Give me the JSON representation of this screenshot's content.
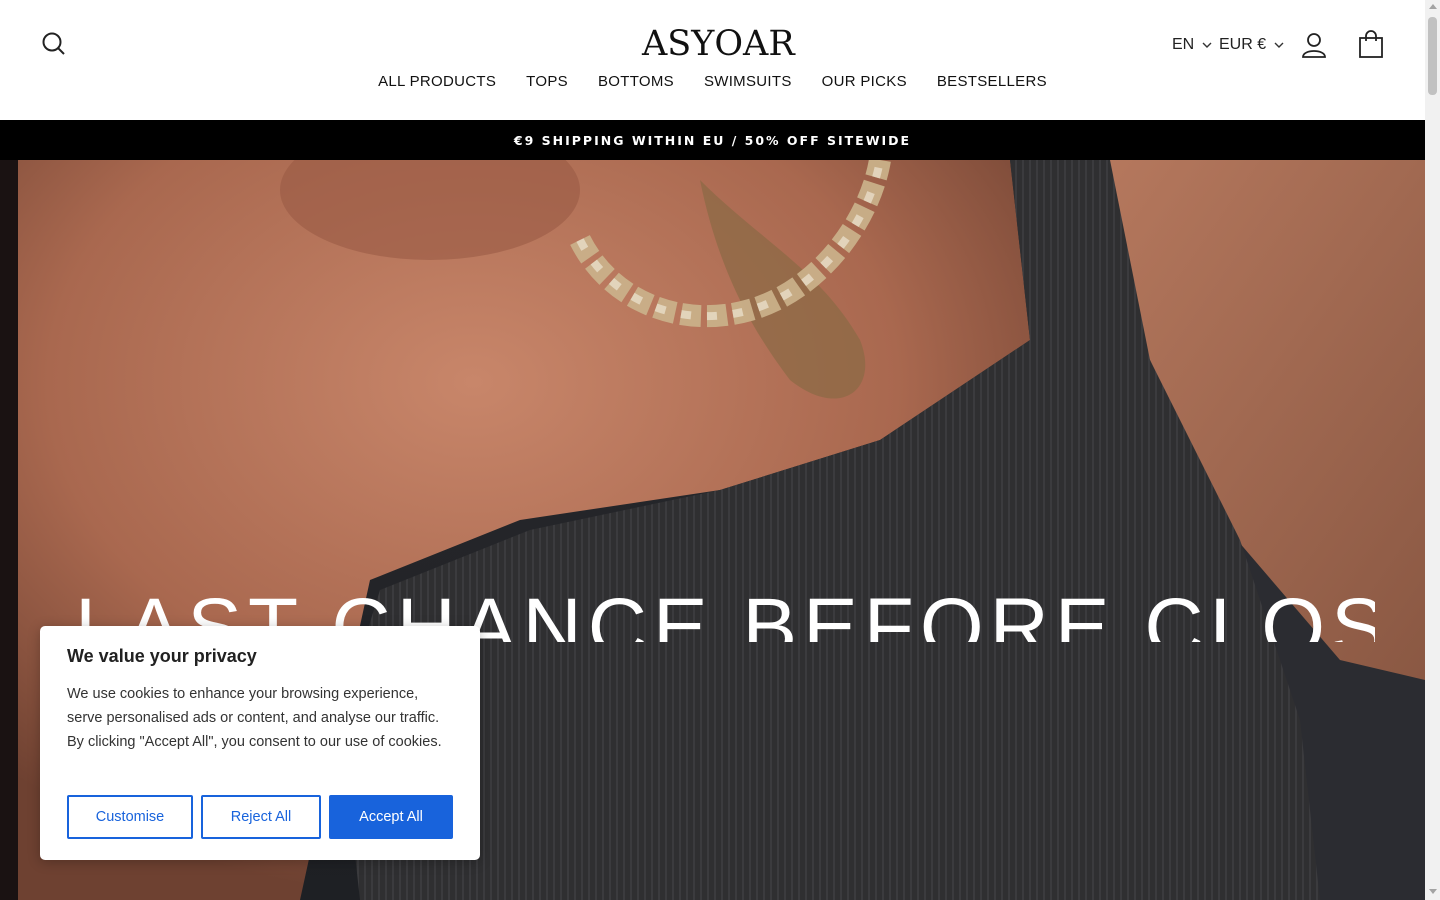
{
  "header": {
    "logo": "ASYOAR",
    "language": "EN",
    "currency": "EUR €",
    "nav": [
      "ALL PRODUCTS",
      "TOPS",
      "BOTTOMS",
      "SWIMSUITS",
      "OUR PICKS",
      "BESTSELLERS"
    ]
  },
  "announcement": "€9 SHIPPING WITHIN EU / 50% OFF SITEWIDE",
  "hero": {
    "title": "LAST CHANCE BEFORE CLOSING"
  },
  "cookie": {
    "title": "We value your privacy",
    "body": "We use cookies to enhance your browsing experience, serve personalised ads or content, and analyse our traffic. By clicking \"Accept All\", you consent to our use of cookies.",
    "customise": "Customise",
    "reject": "Reject All",
    "accept": "Accept All"
  },
  "colors": {
    "accent": "#1863dc",
    "announcement_bg": "#000000"
  }
}
